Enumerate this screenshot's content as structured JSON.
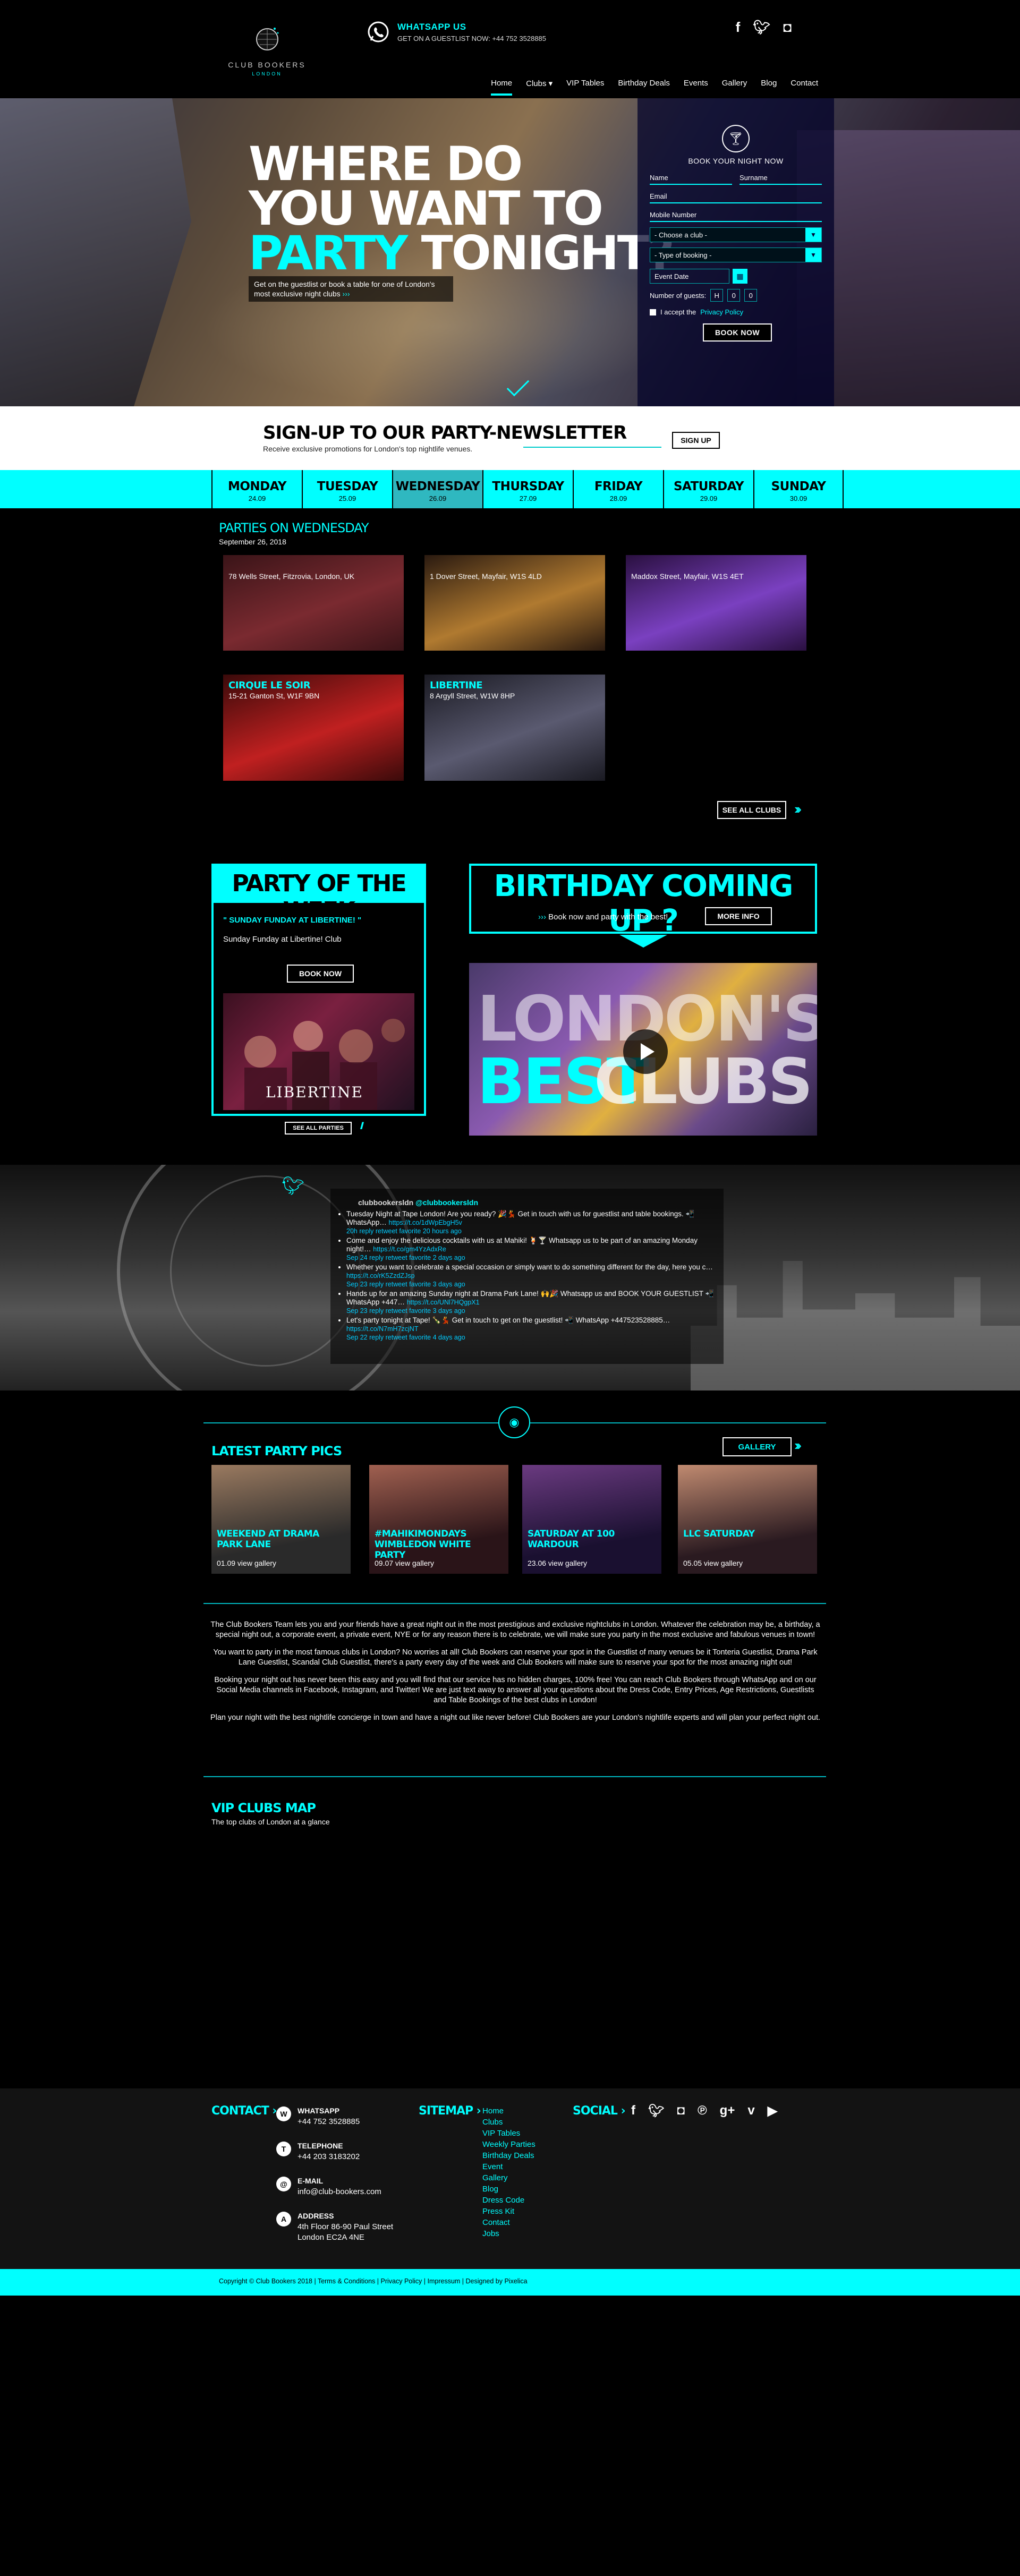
{
  "header": {
    "logo_title": "CLUB BOOKERS",
    "logo_sub": "LONDON",
    "whatsapp_title": "WHATSAPP US",
    "whatsapp_sub": "GET ON A GUESTLIST NOW: +44 752 3528885",
    "social": [
      "f",
      "t",
      "ig"
    ],
    "nav": [
      {
        "label": "Home",
        "active": true
      },
      {
        "label": "Clubs ▾"
      },
      {
        "label": "VIP Tables"
      },
      {
        "label": "Birthday Deals"
      },
      {
        "label": "Events"
      },
      {
        "label": "Gallery"
      },
      {
        "label": "Blog"
      },
      {
        "label": "Contact"
      }
    ]
  },
  "hero": {
    "line1": "WHERE DO",
    "line2": "YOU WANT TO",
    "line3_accent": "PARTY",
    "line3_rest": " TONIGHT?",
    "tagline": "Get on the guestlist or book a table for one of London's most exclusive night clubs",
    "tagline_arrows": "›››"
  },
  "booking": {
    "title": "BOOK YOUR NIGHT NOW",
    "name": "Name",
    "surname": "Surname",
    "email": "Email",
    "mobile": "Mobile Number",
    "club_select": "- Choose a club -",
    "type_select": "- Type of booking -",
    "event_date": "Event Date",
    "guests_label": "Number of guests:",
    "guest_boxes": [
      "H",
      "0",
      "0"
    ],
    "privacy_prefix": "I accept the",
    "privacy_link": "Privacy Policy",
    "button": "BOOK NOW"
  },
  "newsletter": {
    "title": "SIGN-UP TO OUR PARTY-NEWSLETTER",
    "subtitle": "Receive exclusive promotions for London's top nightlife venues.",
    "button": "SIGN UP"
  },
  "week": [
    {
      "day": "MONDAY",
      "date": "24.09"
    },
    {
      "day": "TUESDAY",
      "date": "25.09"
    },
    {
      "day": "WEDNESDAY",
      "date": "26.09",
      "active": true
    },
    {
      "day": "THURSDAY",
      "date": "27.09"
    },
    {
      "day": "FRIDAY",
      "date": "28.09"
    },
    {
      "day": "SATURDAY",
      "date": "29.09"
    },
    {
      "day": "SUNDAY",
      "date": "30.09"
    }
  ],
  "parties": {
    "title": "PARTIES ON WEDNESDAY",
    "date": "September 26, 2018",
    "clubs": [
      {
        "name": "",
        "address": "78 Wells Street, Fitzrovia, London, UK",
        "color1": "#3a1418",
        "color2": "#7a2a30"
      },
      {
        "name": "",
        "address": "1 Dover Street, Mayfair, W1S 4LD",
        "color1": "#2a1a10",
        "color2": "#b07a30"
      },
      {
        "name": "",
        "address": "Maddox Street, Mayfair, W1S 4ET",
        "color1": "#2a1040",
        "color2": "#7a40c0"
      },
      {
        "name": "CIRQUE LE SOIR",
        "address": "15-21 Ganton St, W1F 9BN",
        "color1": "#3a0a0a",
        "color2": "#c02020"
      },
      {
        "name": "LIBERTINE",
        "address": "8 Argyll Street, W1W 8HP",
        "color1": "#1a1a22",
        "color2": "#5a5a70"
      }
    ],
    "see_all": "SEE ALL CLUBS"
  },
  "potw": {
    "title": "PARTY OF THE WEEK",
    "line1": "\" SUNDAY FUNDAY AT LIBERTINE! \"",
    "line2": "Sunday Funday at Libertine! Club",
    "button": "BOOK NOW",
    "img_logo": "LIBERTINE",
    "see_all": "SEE ALL PARTIES"
  },
  "birthday": {
    "title": "BIRTHDAY COMING UP ?",
    "subtitle": "Book now and party with the best!",
    "button": "MORE INFO"
  },
  "video": {
    "line1": "LONDON'S",
    "line2_accent": "BEST",
    "line2_rest": "CLUBS"
  },
  "twitter": {
    "handle": "clubbookersldn",
    "at": "@clubbookersldn",
    "tweets": [
      {
        "text": "Tuesday Night at Tape London! Are you ready? 🎉💃 Get in touch with us for guestlist and table bookings. 📲 WhatsApp…",
        "link": "https://t.co/1dWpEbgH5v",
        "meta": "20h reply retweet favorite 20 hours ago"
      },
      {
        "text": "Come and enjoy the delicious cocktails with us at Mahiki! 🍹🍸 Whatsapp us to be part of an amazing Monday night!…",
        "link": "https://t.co/gm4YzAdxRe",
        "meta": "Sep 24 reply retweet favorite 2 days ago"
      },
      {
        "text": "Whether you want to celebrate a special occasion or simply want to do something different for the day, here you c…",
        "link": "https://t.co/rK5ZzdZJsp",
        "meta": "Sep 23 reply retweet favorite 3 days ago"
      },
      {
        "text": "Hands up for an amazing Sunday night at Drama Park Lane! 🙌🎉 Whatsapp us and BOOK YOUR GUESTLIST 📲 WhatsApp +447…",
        "link": "https://t.co/UNl7HQgpX1",
        "meta": "Sep 23 reply retweet favorite 3 days ago"
      },
      {
        "text": "Let's party tonight at Tape! 🍾💃 Get in touch to get on the guestlist! 📲 WhatsApp +447523528885…",
        "link": "https://t.co/N7mH7zcjNT",
        "meta": "Sep 22 reply retweet favorite 4 days ago"
      }
    ]
  },
  "gallery": {
    "title": "LATEST PARTY PICS",
    "button": "GALLERY",
    "pics": [
      {
        "title": "WEEKEND AT DRAMA PARK LANE",
        "count": "01.09 view gallery",
        "color1": "#2a2a2a",
        "color2": "#9a7a60"
      },
      {
        "title": "#MAHIKIMONDAYS WIMBLEDON WHITE PARTY",
        "count": "09.07 view gallery",
        "color1": "#2a1418",
        "color2": "#a06050"
      },
      {
        "title": "SATURDAY AT 100 WARDOUR",
        "count": "23.06 view gallery",
        "color1": "#1a1030",
        "color2": "#6a3a80"
      },
      {
        "title": "LLC SATURDAY",
        "count": "05.05 view gallery",
        "color1": "#2a1a20",
        "color2": "#c08a70"
      }
    ]
  },
  "about": {
    "p1": "The Club Bookers Team lets you and your friends have a great night out in the most prestigious and exclusive nightclubs in London. Whatever the celebration may be, a birthday, a special night out, a corporate event, a private event, NYE or for any reason there is to celebrate, we will make sure you party in the most exclusive and fabulous venues in town!",
    "p2": "You want to party in the most famous clubs in London? No worries at all! Club Bookers can reserve your spot in the Guestlist of many venues be it Tonteria Guestlist, Drama Park Lane Guestlist, Scandal Club Guestlist, there's a party every day of the week and Club Bookers will make sure to reserve your spot for the most amazing night out!",
    "p3": "Booking your night out has never been this easy and you will find that our service has no hidden charges, 100% free! You can reach Club Bookers through WhatsApp and on our Social Media channels in Facebook, Instagram, and Twitter! We are just text away to answer all your questions about the Dress Code, Entry Prices, Age Restrictions, Guestlists and Table Bookings of the best clubs in London!",
    "p4": "Plan your night with the best nightlife concierge in town and have a night out like never before! Club Bookers are your London's nightlife experts and will plan your perfect night out."
  },
  "map": {
    "title": "VIP CLUBS MAP",
    "subtitle": "The top clubs of London at a glance"
  },
  "footer": {
    "contact_head": "CONTACT ›",
    "contacts": [
      {
        "icon": "W",
        "k": "WHATSAPP",
        "v": "+44 752 3528885"
      },
      {
        "icon": "T",
        "k": "TELEPHONE",
        "v": "+44 203 3183202"
      },
      {
        "icon": "@",
        "k": "E-MAIL",
        "v": "info@club-bookers.com"
      },
      {
        "icon": "A",
        "k": "ADDRESS",
        "v": "4th Floor 86-90 Paul Street London EC2A 4NE"
      }
    ],
    "sitemap_head": "SITEMAP ›",
    "sitemap": [
      "Home",
      "Clubs",
      "VIP Tables",
      "Weekly Parties",
      "Birthday Deals",
      "Event",
      "Gallery",
      "Blog",
      "Dress Code",
      "Press Kit",
      "Contact",
      "Jobs"
    ],
    "social_head": "SOCIAL ›",
    "social": [
      "f",
      "t",
      "ig",
      "p",
      "g+",
      "v",
      "yt"
    ],
    "copyright": "Copyright © Club Bookers 2018 | Terms & Conditions | Privacy Policy | Impressum | Designed by Pixelica"
  }
}
